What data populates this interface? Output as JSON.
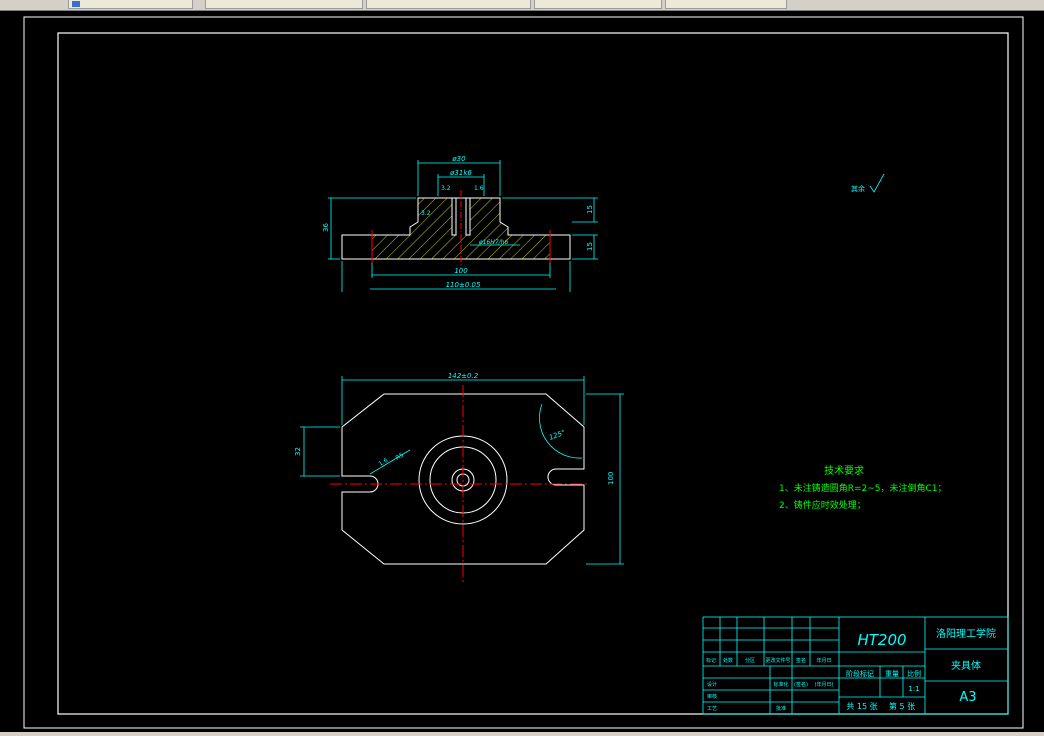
{
  "tabs": [
    {
      "label": ""
    },
    {
      "label": ""
    },
    {
      "label": ""
    },
    {
      "label": ""
    },
    {
      "label": ""
    }
  ],
  "drawing": {
    "dims_top": {
      "d_outer": "ø30",
      "d_bore": "ø31k6",
      "r_tl": "3.2",
      "r_tr": "1.6",
      "r_side": "3.2",
      "fit": "ø16H7/h6",
      "h_total": "36",
      "h_top": "15",
      "h_bottom": "15",
      "w100": "100",
      "w110": "110±0.05"
    },
    "dims_plan": {
      "width": "142±0.2",
      "angle": "125°",
      "h32": "32",
      "h100": "100",
      "r_small": "1.6",
      "r_big": "R5"
    },
    "roughness_note": "其余",
    "tech": {
      "title": "技术要求",
      "line1": "1、未注铸造圆角R=2~5，未注倒角C1；",
      "line2": "2、铸件应时效处理；"
    },
    "title_block": {
      "material": "HT200",
      "school": "洛阳理工学院",
      "part_name": "夹具体",
      "size": "A3",
      "scale": "1:1",
      "total_label": "共 15 张",
      "sheet_label": "第 5 张",
      "stage_label": "阶段标记",
      "weight_label": "重量",
      "ratio_label": "比例",
      "row_labels": [
        "标记",
        "处数",
        "分区",
        "更改文件号",
        "签名",
        "年月日"
      ],
      "left_labels": [
        "设计",
        "审核",
        "工艺"
      ],
      "std_labels": [
        "标准化",
        "批准"
      ],
      "sign_labels": [
        "(签名)",
        "(年月日)"
      ]
    }
  },
  "colors": {
    "frame": "#ffffff",
    "dimension": "#00ffff",
    "center": "#ff0000",
    "hatch": "#ffff00",
    "text_green": "#00ff00",
    "title_block": "#00ffff"
  }
}
